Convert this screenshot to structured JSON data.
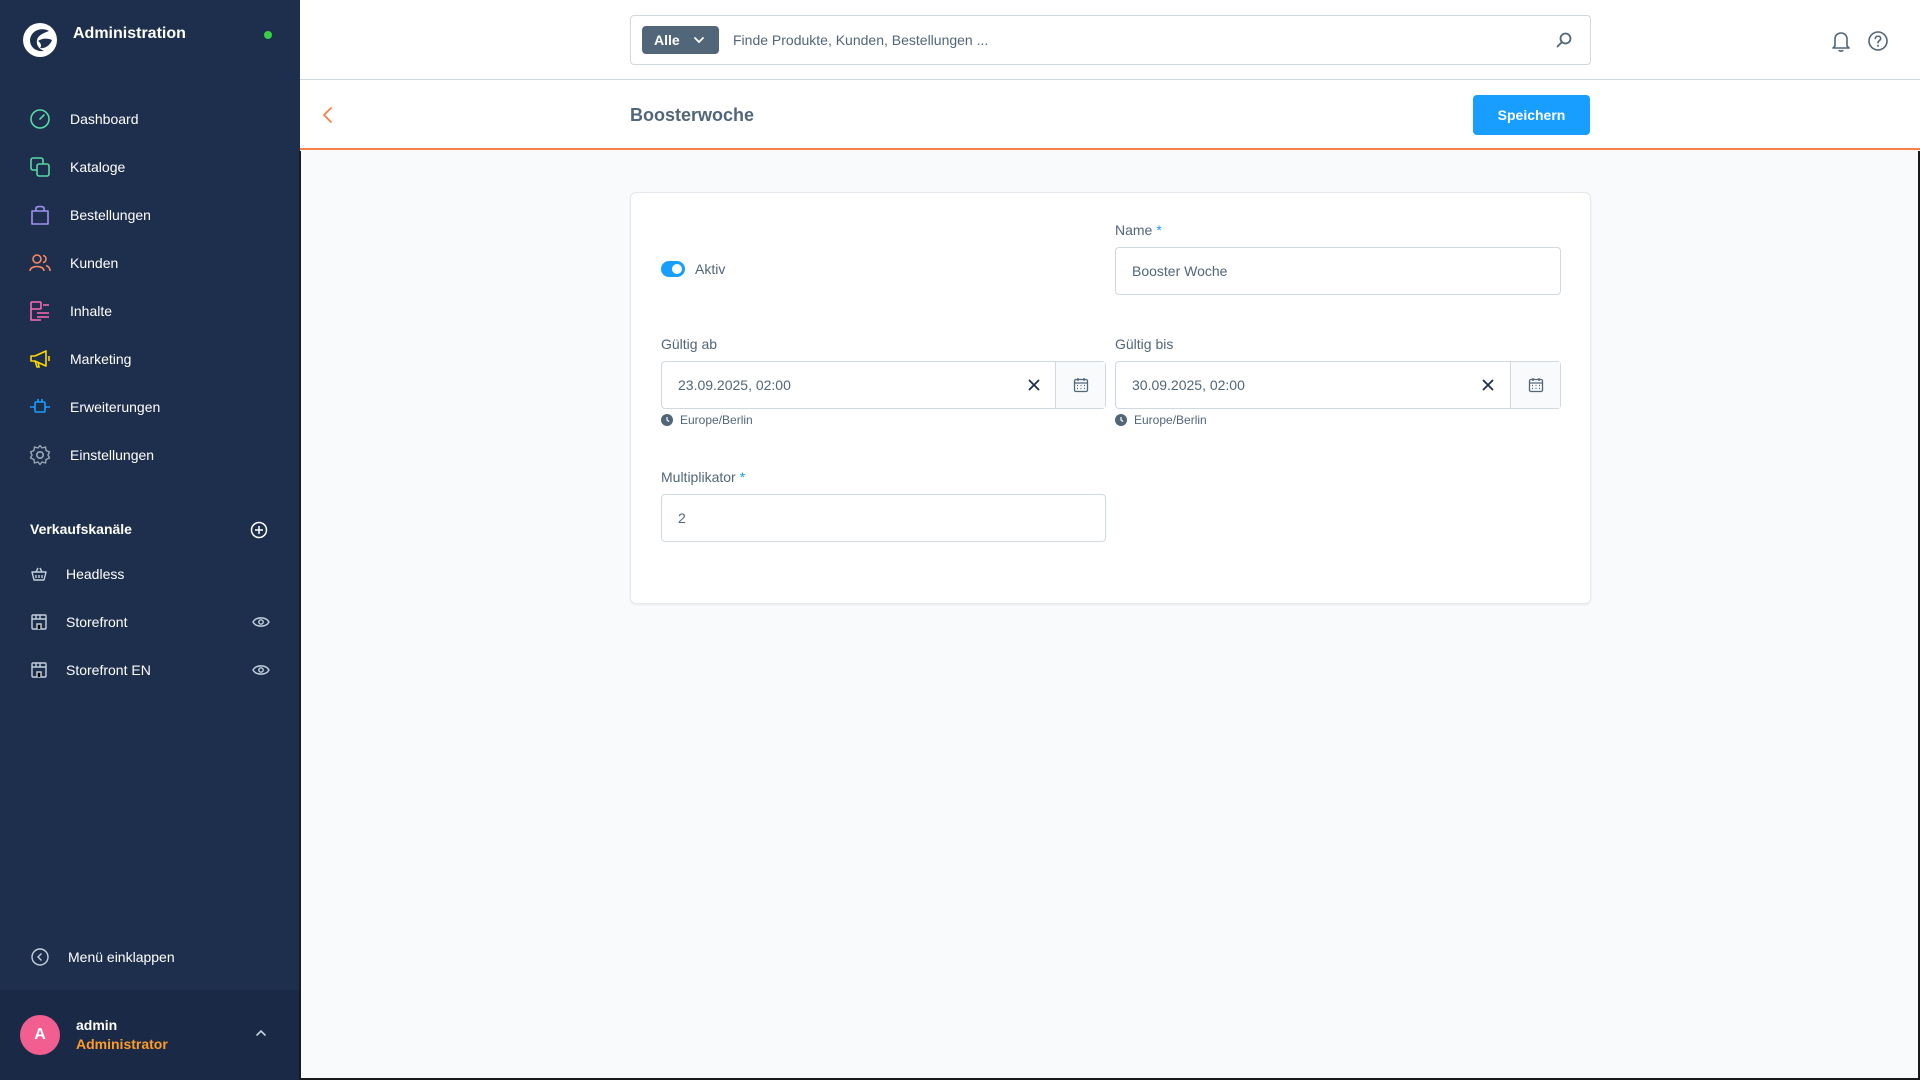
{
  "app": {
    "title": "Administration"
  },
  "sidebar": {
    "nav": [
      {
        "label": "Dashboard",
        "icon": "dashboard-icon",
        "color": "#57d9a3"
      },
      {
        "label": "Kataloge",
        "icon": "catalog-icon",
        "color": "#57d9a3"
      },
      {
        "label": "Bestellungen",
        "icon": "orders-icon",
        "color": "#a092f0"
      },
      {
        "label": "Kunden",
        "icon": "customers-icon",
        "color": "#f88962"
      },
      {
        "label": "Inhalte",
        "icon": "content-icon",
        "color": "#ff68b4"
      },
      {
        "label": "Marketing",
        "icon": "marketing-icon",
        "color": "#ffd700"
      },
      {
        "label": "Erweiterungen",
        "icon": "extensions-icon",
        "color": "#189eff"
      },
      {
        "label": "Einstellungen",
        "icon": "settings-icon",
        "color": "#9aa8b5"
      }
    ],
    "sales_channels_title": "Verkaufskanäle",
    "sales_channels": [
      {
        "label": "Headless",
        "icon": "basket-icon",
        "has_eye": false
      },
      {
        "label": "Storefront",
        "icon": "storefront-icon",
        "has_eye": true
      },
      {
        "label": "Storefront EN",
        "icon": "storefront-icon",
        "has_eye": true
      }
    ],
    "collapse_label": "Menü einklappen",
    "user": {
      "initial": "A",
      "name": "admin",
      "role": "Administrator"
    }
  },
  "search": {
    "type_label": "Alle",
    "placeholder": "Finde Produkte, Kunden, Bestellungen ..."
  },
  "smartbar": {
    "title": "Boosterwoche",
    "save_label": "Speichern"
  },
  "form": {
    "active_label": "Aktiv",
    "active": true,
    "name_label": "Name",
    "name_value": "Booster Woche",
    "valid_from_label": "Gültig ab",
    "valid_from_value": "23.09.2025, 02:00",
    "valid_from_tz": "Europe/Berlin",
    "valid_until_label": "Gültig bis",
    "valid_until_value": "30.09.2025, 02:00",
    "valid_until_tz": "Europe/Berlin",
    "multiplier_label": "Multiplikator",
    "multiplier_value": "2",
    "required_mark": "*"
  }
}
